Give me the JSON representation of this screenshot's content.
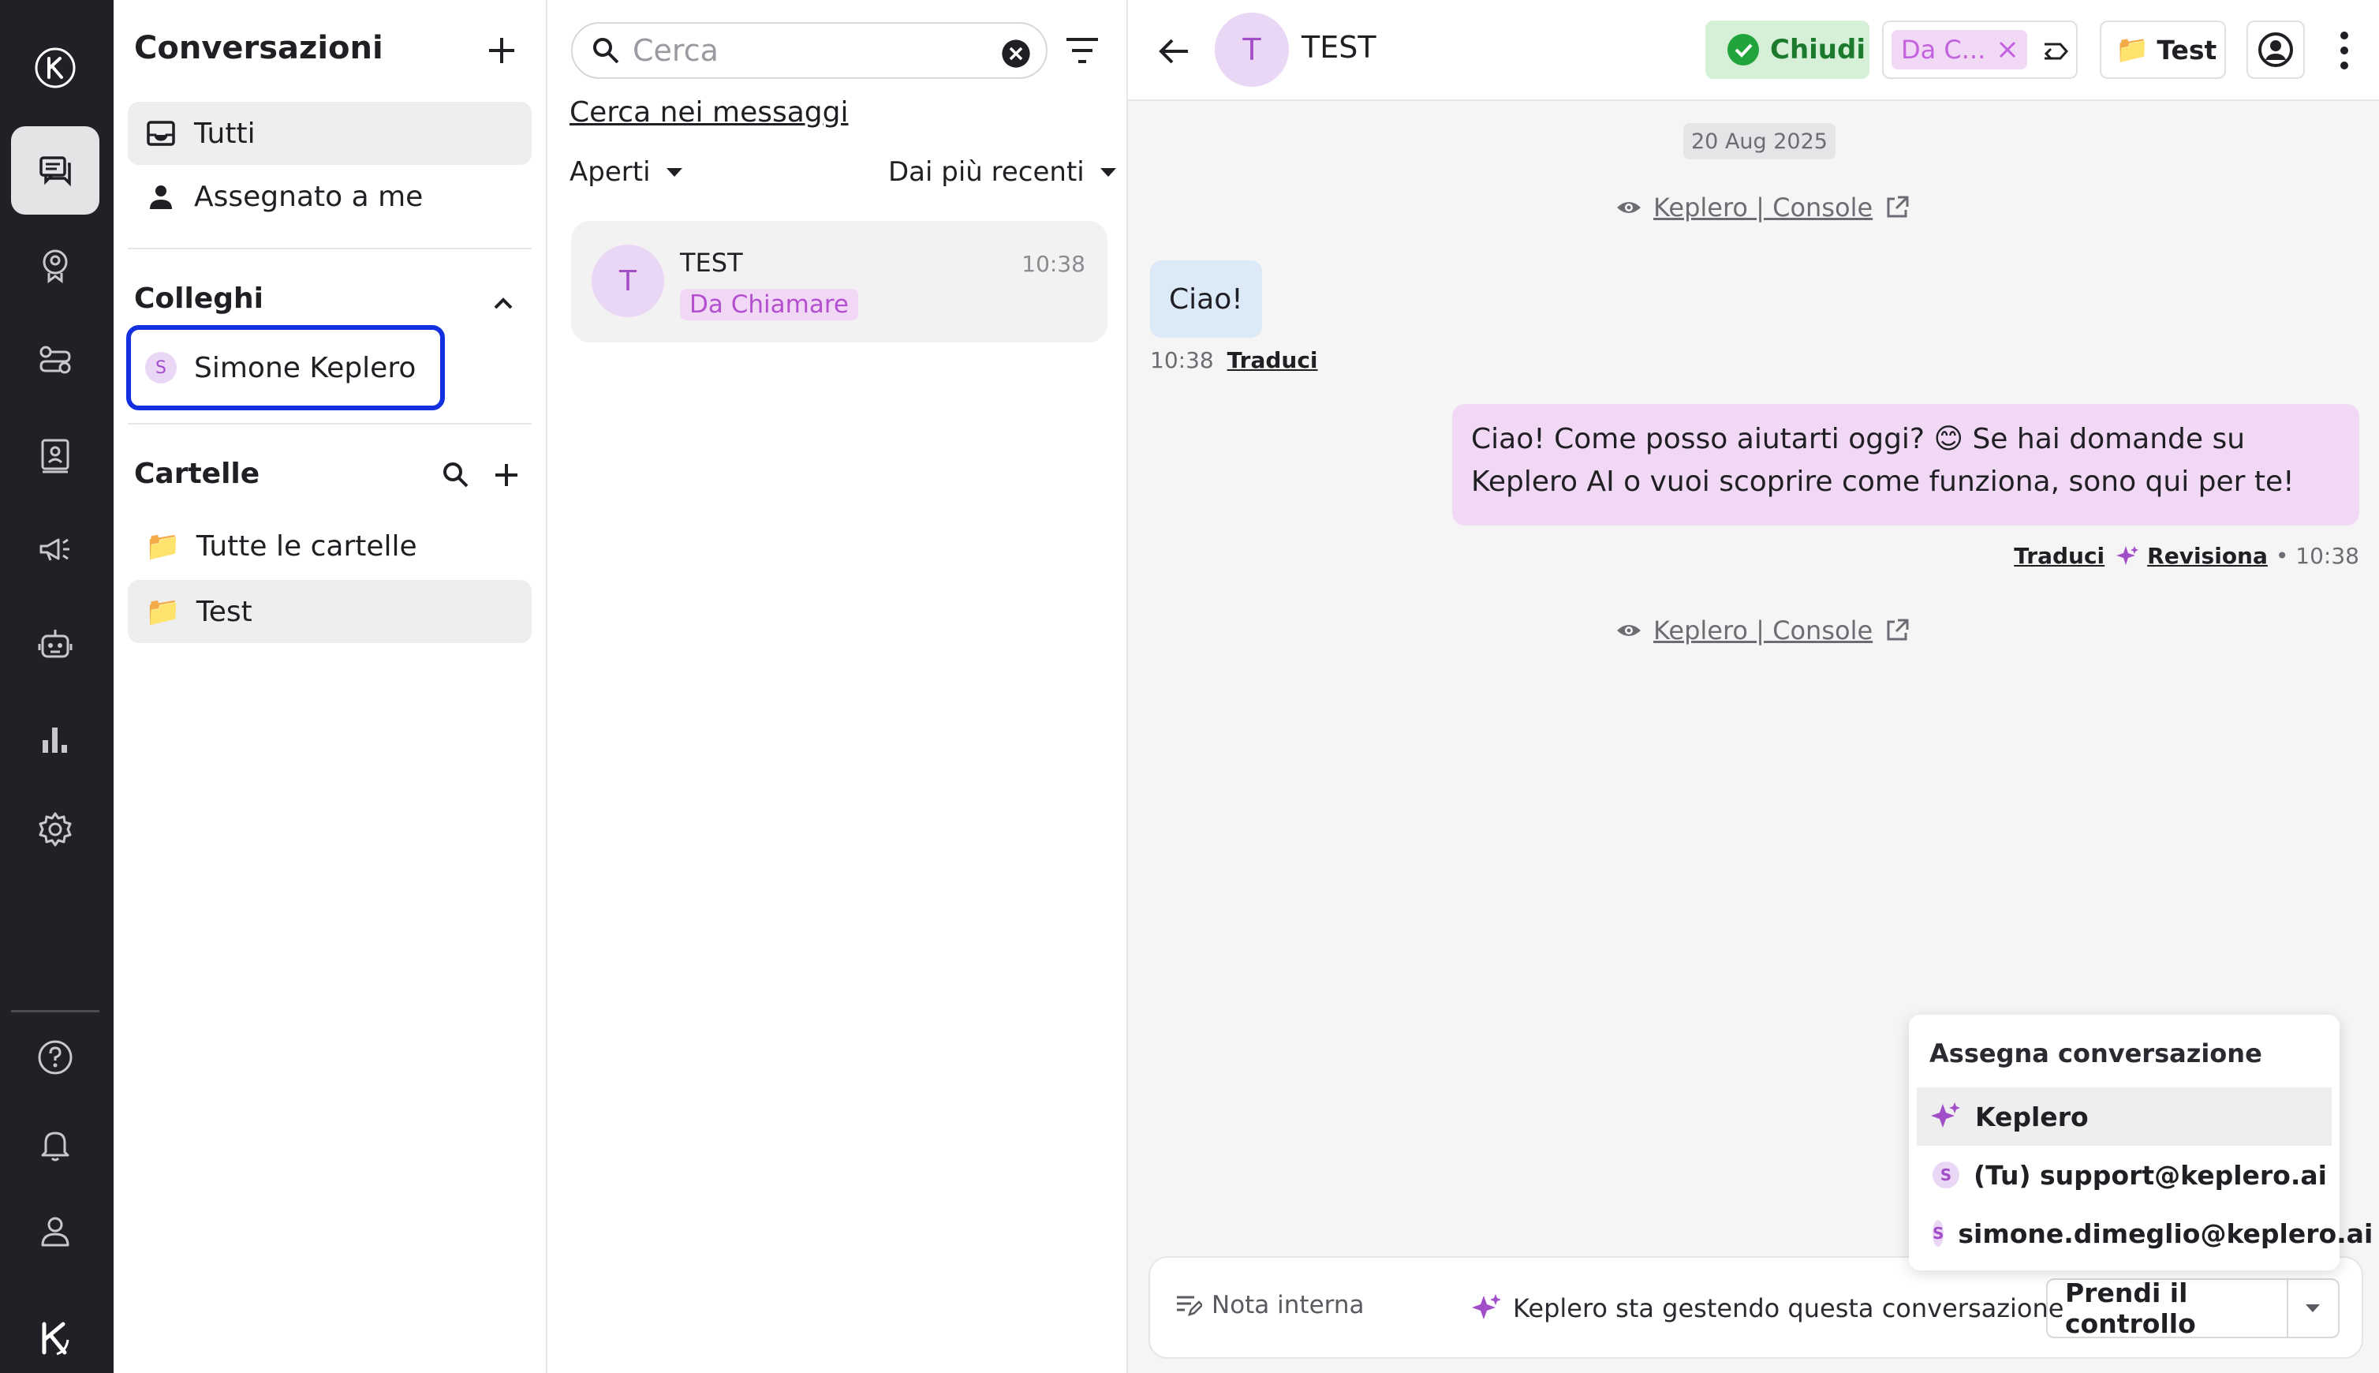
{
  "rail": {
    "items": [
      "logo",
      "conversations",
      "contacts",
      "flows",
      "knowledge",
      "campaigns",
      "bots",
      "analytics",
      "settings",
      "help",
      "notifications",
      "profile",
      "brand"
    ]
  },
  "sidebar": {
    "title": "Conversazioni",
    "views": [
      {
        "label": "Tutti",
        "selected": true
      },
      {
        "label": "Assegnato a me",
        "selected": false
      }
    ],
    "colleagues_title": "Colleghi",
    "colleague": {
      "initial": "S",
      "name": "Simone Keplero"
    },
    "folders_title": "Cartelle",
    "folders": [
      {
        "label": "Tutte le cartelle",
        "selected": false
      },
      {
        "label": "Test",
        "selected": true
      }
    ],
    "folder_glyph": "📁"
  },
  "list": {
    "search_placeholder": "Cerca",
    "search_messages": "Cerca nei messaggi",
    "status_filter": "Aperti",
    "sort": "Dai più recenti",
    "conversation": {
      "initial": "T",
      "name": "TEST",
      "time": "10:38",
      "tag": "Da Chiamare"
    }
  },
  "chat": {
    "initial": "T",
    "name": "TEST",
    "close_label": "Chiudi",
    "status_tag": "Da C...",
    "folder_label": "Test",
    "date": "20 Aug 2025",
    "source_link": "Keplero | Console",
    "incoming": {
      "text": "Ciao!",
      "time": "10:38",
      "translate": "Traduci"
    },
    "outgoing": {
      "text": "Ciao! Come posso aiutarti oggi? 😊 Se hai domande su Keplero AI o vuoi scoprire come funziona, sono qui per te!",
      "translate": "Traduci",
      "review": "Revisiona",
      "time_suffix": "• 10:38"
    },
    "assign_menu": {
      "title": "Assegna conversazione",
      "options": [
        {
          "label": "Keplero",
          "type": "ai",
          "highlighted": true
        },
        {
          "label": "(Tu) support@keplero.ai",
          "type": "user",
          "initial": "S"
        },
        {
          "label": "simone.dimeglio@keplero.ai",
          "type": "user",
          "initial": "S"
        }
      ]
    },
    "composer": {
      "note_label": "Nota interna",
      "handling_text": "Keplero sta gestendo questa conversazione",
      "takeover_label": "Prendi il controllo"
    }
  },
  "colors": {
    "rail_bg": "#1f2126",
    "accent_purple": "#a24ec9",
    "tag_bg": "#f1d9f6",
    "success_green": "#22a43c",
    "focus_blue": "#1230e0"
  }
}
